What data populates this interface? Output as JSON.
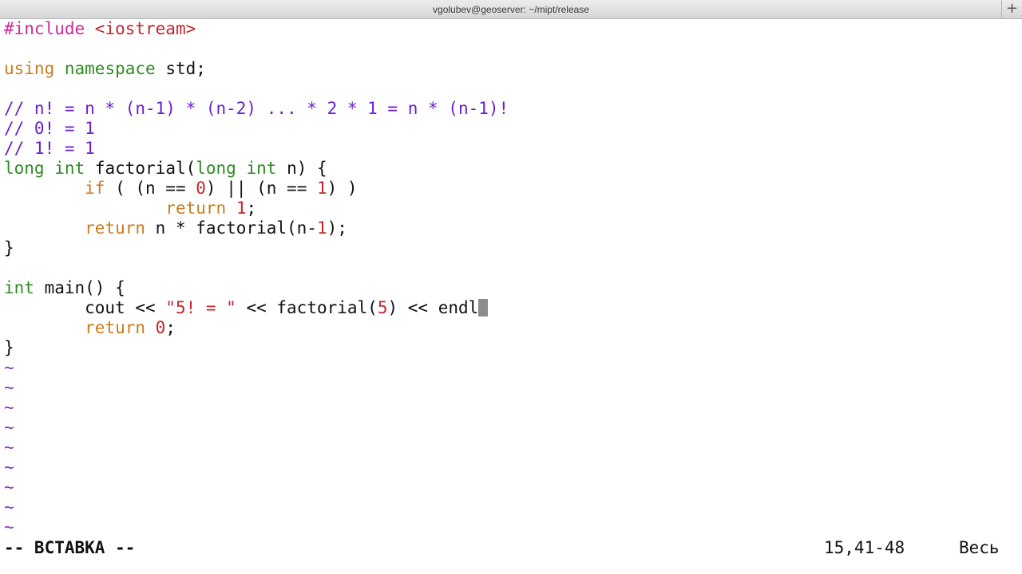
{
  "window": {
    "title": "vgolubev@geoserver: ~/mipt/release",
    "new_tab": "+"
  },
  "editor": {
    "lines": [
      [
        {
          "t": "#include ",
          "c": "pp"
        },
        {
          "t": "<iostream>",
          "c": "str"
        }
      ],
      [],
      [
        {
          "t": "using",
          "c": "kw"
        },
        {
          "t": " "
        },
        {
          "t": "namespace",
          "c": "ty"
        },
        {
          "t": " std;"
        }
      ],
      [],
      [
        {
          "t": "// n! = n * (n-1) * (n-2) ... * 2 * 1 = n * (n-1)!",
          "c": "cm"
        }
      ],
      [
        {
          "t": "// 0! = 1",
          "c": "cm"
        }
      ],
      [
        {
          "t": "// 1! = 1",
          "c": "cm"
        }
      ],
      [
        {
          "t": "long",
          "c": "ty"
        },
        {
          "t": " "
        },
        {
          "t": "int",
          "c": "ty"
        },
        {
          "t": " factorial("
        },
        {
          "t": "long",
          "c": "ty"
        },
        {
          "t": " "
        },
        {
          "t": "int",
          "c": "ty"
        },
        {
          "t": " n) {"
        }
      ],
      [
        {
          "t": "        "
        },
        {
          "t": "if",
          "c": "kw"
        },
        {
          "t": " ( (n == "
        },
        {
          "t": "0",
          "c": "num"
        },
        {
          "t": ") || (n == "
        },
        {
          "t": "1",
          "c": "num"
        },
        {
          "t": ") )"
        }
      ],
      [
        {
          "t": "                "
        },
        {
          "t": "return",
          "c": "kw"
        },
        {
          "t": " "
        },
        {
          "t": "1",
          "c": "num"
        },
        {
          "t": ";"
        }
      ],
      [
        {
          "t": "        "
        },
        {
          "t": "return",
          "c": "kw"
        },
        {
          "t": " n * factorial(n-"
        },
        {
          "t": "1",
          "c": "num"
        },
        {
          "t": ");"
        }
      ],
      [
        {
          "t": "}"
        }
      ],
      [],
      [
        {
          "t": "int",
          "c": "ty"
        },
        {
          "t": " main() {"
        }
      ],
      [
        {
          "t": "        cout << "
        },
        {
          "t": "\"5! = \"",
          "c": "str"
        },
        {
          "t": " << factorial("
        },
        {
          "t": "5",
          "c": "num"
        },
        {
          "t": ") << endl"
        }
      ],
      [
        {
          "t": "        "
        },
        {
          "t": "return",
          "c": "kw"
        },
        {
          "t": " "
        },
        {
          "t": "0",
          "c": "num"
        },
        {
          "t": ";"
        }
      ],
      [
        {
          "t": "}"
        }
      ]
    ],
    "cursor_line": 14,
    "tilde": "~",
    "tilde_count": 9
  },
  "statusbar": {
    "mode": "-- ВСТАВКА --",
    "position": "15,41-48",
    "scroll": "Весь"
  }
}
